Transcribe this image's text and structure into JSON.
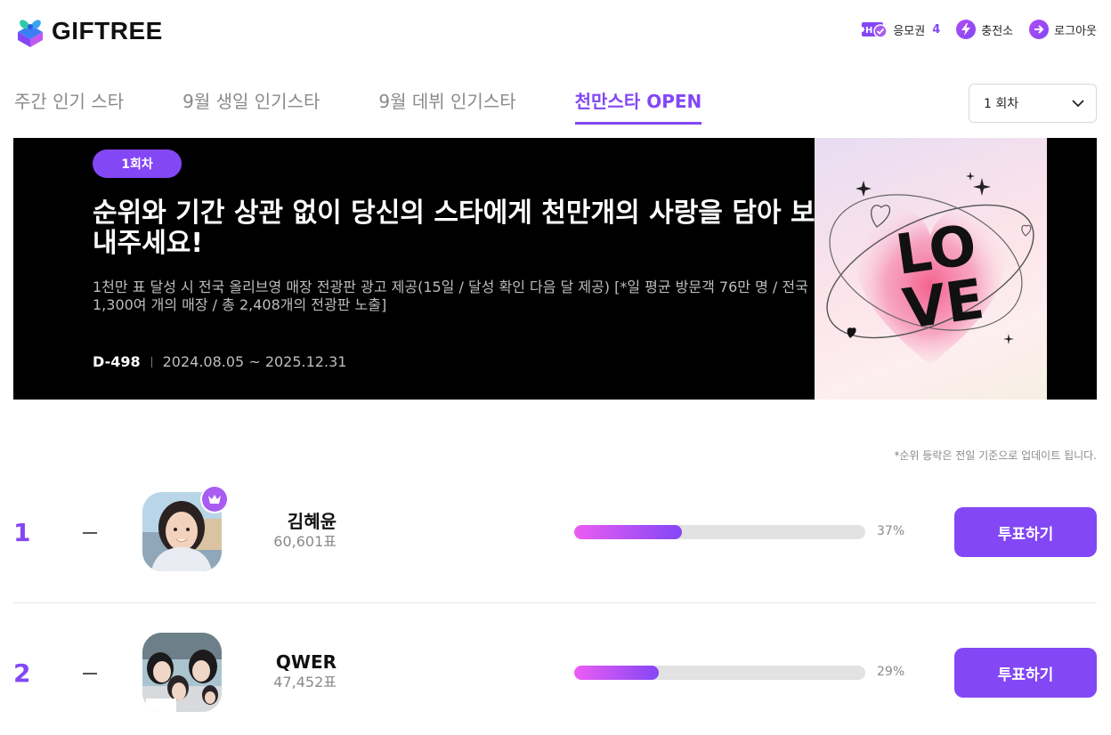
{
  "header": {
    "brand": "GIFTREE",
    "ticket_label": "응모권",
    "ticket_count": "4",
    "charge_label": "충전소",
    "logout_label": "로그아웃"
  },
  "tabs": [
    {
      "label": "주간 인기 스타",
      "active": false
    },
    {
      "label": "9월 생일 인기스타",
      "active": false
    },
    {
      "label": "9월 데뷔 인기스타",
      "active": false
    },
    {
      "label": "천만스타 OPEN",
      "active": true
    }
  ],
  "round_select": {
    "value": "1 회차"
  },
  "banner": {
    "badge": "1회차",
    "title": "순위와 기간 상관 없이 당신의 스타에게 천만개의 사랑을 담아 보내주세요!",
    "description": "1천만 표 달성 시 전국 올리브영 매장 전광판 광고 제공(15일 / 달성 확인 다음 달 제공) [*일 평균 방문객 76만 명 / 전국 1,300여 개의 매장 / 총 2,408개의 전광판 노출]",
    "dday": "D-498",
    "period": "2024.08.05 ~ 2025.12.31",
    "art_text_top": "LO",
    "art_text_bottom": "VE"
  },
  "notice": "*순위 등락은 전일 기준으로 업데이트 됩니다.",
  "ranking": [
    {
      "rank": "1",
      "name": "김혜윤",
      "votes": "60,601표",
      "percent_label": "37%",
      "percent": 37,
      "button": "투표하기",
      "crown": true
    },
    {
      "rank": "2",
      "name": "QWER",
      "votes": "47,452표",
      "percent_label": "29%",
      "percent": 29,
      "button": "투표하기",
      "crown": false
    }
  ],
  "colors": {
    "accent": "#8347f5",
    "gradient_start": "#ec5cf3"
  }
}
